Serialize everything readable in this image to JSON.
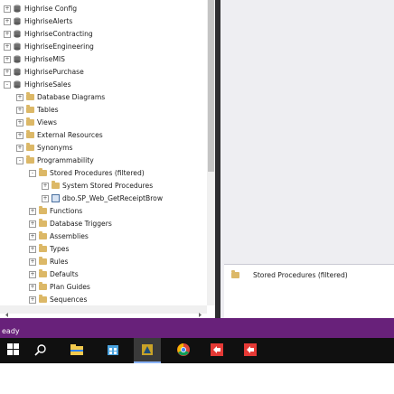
{
  "tree": [
    {
      "label": "Highrise Config",
      "icon": "db",
      "expander": "+"
    },
    {
      "label": "HighriseAlerts",
      "icon": "db",
      "expander": "+"
    },
    {
      "label": "HighriseContracting",
      "icon": "db",
      "expander": "+"
    },
    {
      "label": "HighriseEngineering",
      "icon": "db",
      "expander": "+"
    },
    {
      "label": "HighriseMIS",
      "icon": "db",
      "expander": "+"
    },
    {
      "label": "HighrisePurchase",
      "icon": "db",
      "expander": "+"
    },
    {
      "label": "HighriseSales",
      "icon": "db",
      "expander": "-"
    },
    {
      "label": "Database Diagrams",
      "icon": "folder",
      "expander": "+"
    },
    {
      "label": "Tables",
      "icon": "folder",
      "expander": "+"
    },
    {
      "label": "Views",
      "icon": "folder",
      "expander": "+"
    },
    {
      "label": "External Resources",
      "icon": "folder",
      "expander": "+"
    },
    {
      "label": "Synonyms",
      "icon": "folder",
      "expander": "+"
    },
    {
      "label": "Programmability",
      "icon": "folder",
      "expander": "-"
    },
    {
      "label": "Stored Procedures (filtered)",
      "icon": "folder",
      "expander": "-"
    },
    {
      "label": "System Stored Procedures",
      "icon": "folder",
      "expander": "+"
    },
    {
      "label": "dbo.SP_Web_GetReceiptBrow",
      "icon": "table",
      "expander": "+"
    },
    {
      "label": "Functions",
      "icon": "folder",
      "expander": "+"
    },
    {
      "label": "Database Triggers",
      "icon": "folder",
      "expander": "+"
    },
    {
      "label": "Assemblies",
      "icon": "folder",
      "expander": "+"
    },
    {
      "label": "Types",
      "icon": "folder",
      "expander": "+"
    },
    {
      "label": "Rules",
      "icon": "folder",
      "expander": "+"
    },
    {
      "label": "Defaults",
      "icon": "folder",
      "expander": "+"
    },
    {
      "label": "Plan Guides",
      "icon": "folder",
      "expander": "+"
    },
    {
      "label": "Sequences",
      "icon": "folder",
      "expander": "+"
    }
  ],
  "details": {
    "item_label": "Stored Procedures (filtered)"
  },
  "status": {
    "text": "eady"
  },
  "colors": {
    "status_bar": "#68217a",
    "taskbar": "#101010",
    "folder": "#dcb867"
  },
  "taskbar": {
    "items": [
      "windows-start",
      "search",
      "file-explorer",
      "app-store",
      "highlighted-app",
      "chrome",
      "red-app-1",
      "red-app-2"
    ]
  }
}
